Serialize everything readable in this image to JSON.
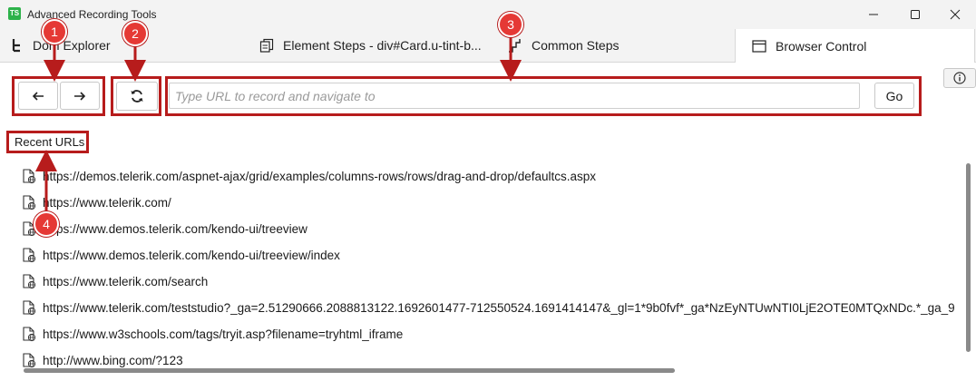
{
  "window": {
    "app_badge": "TS",
    "title": "Advanced Recording Tools"
  },
  "tabs": [
    {
      "label": "Dom Explorer",
      "icon": "dom-tree-icon"
    },
    {
      "label": "Element Steps - div#Card.u-tint-b...",
      "icon": "steps-stack-icon"
    },
    {
      "label": "Common Steps",
      "icon": "stairs-icon"
    },
    {
      "label": "Browser Control",
      "icon": "browser-window-icon",
      "active": true
    }
  ],
  "toolbar": {
    "back_icon": "arrow-left-icon",
    "forward_icon": "arrow-right-icon",
    "refresh_icon": "refresh-icon",
    "url_value": "",
    "url_placeholder": "Type URL to record and navigate to",
    "go_label": "Go",
    "info_icon": "info-icon"
  },
  "recent": {
    "label": "Recent URLs",
    "item_icon": "web-page-icon",
    "urls": [
      "https://demos.telerik.com/aspnet-ajax/grid/examples/columns-rows/rows/drag-and-drop/defaultcs.aspx",
      "https://www.telerik.com/",
      "https://www.demos.telerik.com/kendo-ui/treeview",
      "https://www.demos.telerik.com/kendo-ui/treeview/index",
      "https://www.telerik.com/search",
      "https://www.telerik.com/teststudio?_ga=2.51290666.2088813122.1692601477-712550524.1691414147&_gl=1*9b0fvf*_ga*NzEyNTUwNTI0LjE2OTE0MTQxNDc.*_ga_9",
      "https://www.w3schools.com/tags/tryit.asp?filename=tryhtml_iframe",
      "http://www.bing.com/?123"
    ]
  },
  "annotations": {
    "color": "#e53935",
    "badges": [
      "1",
      "2",
      "3",
      "4"
    ]
  },
  "colors": {
    "highlight": "#b71c1c",
    "badge_fill": "#e53935",
    "app_logo": "#2db24a"
  }
}
